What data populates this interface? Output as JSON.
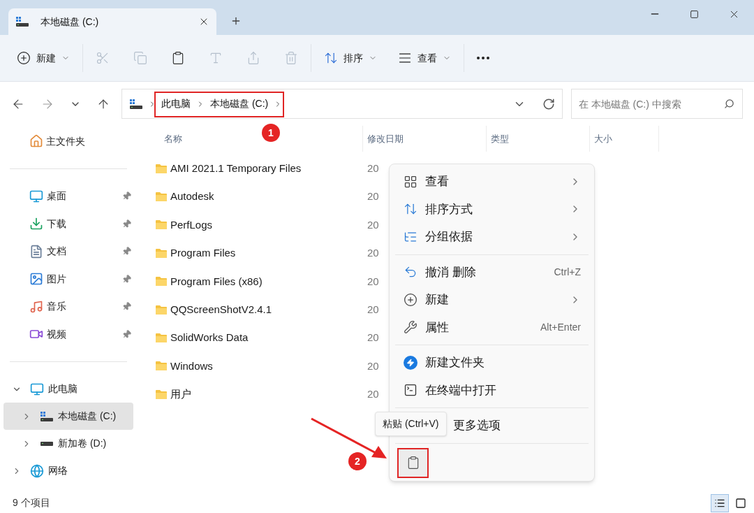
{
  "window": {
    "tab_title": "本地磁盘 (C:)"
  },
  "toolbar": {
    "groups": [
      [
        {
          "kind": "new",
          "label": "新建",
          "disabled": false
        }
      ],
      [
        {
          "kind": "cut",
          "disabled": true
        },
        {
          "kind": "copy",
          "disabled": true
        },
        {
          "kind": "paste",
          "disabled": false
        },
        {
          "kind": "rename",
          "disabled": true
        },
        {
          "kind": "share",
          "disabled": true
        },
        {
          "kind": "delete",
          "disabled": true
        }
      ],
      [
        {
          "kind": "sort",
          "label": "排序",
          "disabled": false
        },
        {
          "kind": "view",
          "label": "查看",
          "disabled": false
        }
      ],
      [
        {
          "kind": "more",
          "disabled": false
        }
      ]
    ]
  },
  "address": {
    "breadcrumb": [
      "此电脑",
      "本地磁盘 (C:)"
    ],
    "search_placeholder": "在 本地磁盘 (C:) 中搜索"
  },
  "sidebar": {
    "home": "主文件夹",
    "quick_access": [
      {
        "kind": "desktop",
        "label": "桌面",
        "pinned": true
      },
      {
        "kind": "downloads",
        "label": "下载",
        "pinned": true
      },
      {
        "kind": "documents",
        "label": "文档",
        "pinned": true
      },
      {
        "kind": "pictures",
        "label": "图片",
        "pinned": true
      },
      {
        "kind": "music",
        "label": "音乐",
        "pinned": true
      },
      {
        "kind": "videos",
        "label": "视频",
        "pinned": true
      }
    ],
    "tree": [
      {
        "kind": "pc",
        "label": "此电脑",
        "expanded": true,
        "selected": false,
        "children": [
          {
            "kind": "drive_c",
            "label": "本地磁盘 (C:)",
            "expanded": false,
            "selected": true
          },
          {
            "kind": "drive",
            "label": "新加卷 (D:)",
            "expanded": false,
            "selected": false
          }
        ]
      },
      {
        "kind": "network",
        "label": "网络",
        "expanded": false,
        "selected": false
      }
    ]
  },
  "table": {
    "columns": [
      "名称",
      "修改日期",
      "类型",
      "大小"
    ],
    "rows": [
      {
        "name": "AMI 2021.1 Temporary Files",
        "date": "20"
      },
      {
        "name": "Autodesk",
        "date": "20"
      },
      {
        "name": "PerfLogs",
        "date": "20"
      },
      {
        "name": "Program Files",
        "date": "20"
      },
      {
        "name": "Program Files (x86)",
        "date": "20"
      },
      {
        "name": "QQScreenShotV2.4.1",
        "date": "20"
      },
      {
        "name": "SolidWorks Data",
        "date": "20"
      },
      {
        "name": "Windows",
        "date": "20"
      },
      {
        "name": "用户",
        "date": "20"
      }
    ]
  },
  "context_menu": {
    "groups": [
      [
        {
          "kind": "view",
          "label": "查看",
          "submenu": true
        },
        {
          "kind": "sort",
          "label": "排序方式",
          "submenu": true
        },
        {
          "kind": "group",
          "label": "分组依据",
          "submenu": true
        }
      ],
      [
        {
          "kind": "undo",
          "label": "撤消 删除",
          "shortcut": "Ctrl+Z",
          "submenu": false
        },
        {
          "kind": "new",
          "label": "新建",
          "submenu": true
        },
        {
          "kind": "properties",
          "label": "属性",
          "shortcut": "Alt+Enter",
          "submenu": false
        }
      ],
      [
        {
          "kind": "new_folder",
          "label": "新建文件夹",
          "submenu": false
        },
        {
          "kind": "terminal",
          "label": "在终端中打开",
          "submenu": false
        }
      ],
      [
        {
          "kind": "more",
          "label": "更多选项",
          "submenu": false
        }
      ]
    ],
    "quick_actions": [
      {
        "kind": "paste",
        "highlighted": true
      }
    ],
    "tooltip": "粘贴 (Ctrl+V)"
  },
  "status_bar": {
    "item_count": "9 个项目",
    "views": [
      {
        "kind": "details",
        "selected": true
      },
      {
        "kind": "tiles",
        "selected": false
      }
    ]
  },
  "annotations": [
    {
      "label": "1"
    },
    {
      "label": "2"
    }
  ]
}
